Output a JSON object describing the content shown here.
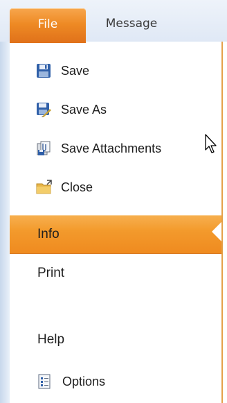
{
  "tabs": {
    "file": "File",
    "message": "Message"
  },
  "commands": [
    {
      "label": "Save",
      "icon": "floppy-disk-icon"
    },
    {
      "label": "Save As",
      "icon": "save-as-icon"
    },
    {
      "label": "Save Attachments",
      "icon": "save-attachments-icon"
    },
    {
      "label": "Close",
      "icon": "folder-close-icon"
    }
  ],
  "sections": [
    {
      "label": "Info",
      "active": true
    },
    {
      "label": "Print",
      "active": false
    },
    {
      "label": "Help",
      "active": false
    }
  ],
  "options": {
    "label": "Options",
    "icon": "options-icon"
  },
  "colors": {
    "accent_orange": "#ef8a1f",
    "tab_background": "#dfe8f5"
  }
}
